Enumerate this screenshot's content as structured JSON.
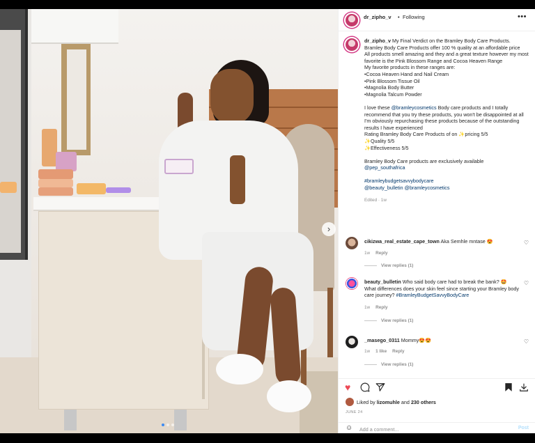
{
  "post": {
    "username": "dr_zipho_v",
    "separator": "•",
    "follow_status": "Following",
    "more_icon": "ellipsis-icon"
  },
  "caption": {
    "username": "dr_zipho_v",
    "lines": [
      "My Final Verdict on the Bramley Body Care Products.",
      "Bramley Body Care Products offer 100 % quality at an affordable price",
      "All products smell amazing and they and a great texture however my most favorite is the Pink Blossom Range and Cocoa Heaven Range",
      "My favorite products in these ranges are:",
      "•Cocoa Heaven Hand and Nail Cream",
      "•Pink Blossom Tissue Oil",
      "•Magnolia Body Butter",
      "•Magnolia Talcum Powder"
    ],
    "para2_prefix": "I love these ",
    "para2_tag": "@bramleycosmetics",
    "para2_suffix": " Body care products and I totally recommend that you try these products, you won't be disappointed at all",
    "para2_lines": [
      "I'm obviously repurchasing these products because of the outstanding results I have experienced",
      "Rating Bramley Body Care Products of on ✨pricing 5/5",
      "✨Quality 5/5",
      "✨Effectiveness 5/5"
    ],
    "para3": "Bramley Body Care products are exclusively available",
    "para3_tag": "@pep_southafrica",
    "hashtag": "#bramleybudgetsavvybodycare",
    "tag_a": "@beauty_bulletin",
    "tag_b": "@bramleycosmetics",
    "edited": "Edited · 1w"
  },
  "comments": [
    {
      "username": "cikizwa_real_estate_cape_town",
      "text": " Aka Semhle mntase 😍",
      "age": "1w",
      "reply": "Reply",
      "view_replies": "View replies (1)"
    },
    {
      "username": "beauty_bulletin",
      "text": " Who said body care had to break the bank? 🤩 What differences does your skin feel since starting your Bramley body care journey? ",
      "tag": "#BramleyBudgetSavvyBodyCare",
      "age": "1w",
      "reply": "Reply",
      "view_replies": "View replies (1)"
    },
    {
      "username": "_masego_0311",
      "text": " Mommy😍😍",
      "age": "1w",
      "likes": "1 like",
      "reply": "Reply",
      "view_replies": "View replies (1)"
    }
  ],
  "actions": {
    "like_icon": "heart-filled-icon",
    "comment_icon": "comment-icon",
    "share_icon": "share-icon",
    "save_icon": "bookmark-icon",
    "download_icon": "download-icon"
  },
  "likes": {
    "prefix": "Liked by ",
    "user": "lizomuhle",
    "middle": " and ",
    "others": "230 others"
  },
  "date": "JUNE 24",
  "add_comment": {
    "placeholder": "Add a comment...",
    "post_label": "Post"
  },
  "colors": {
    "accent_blue": "#0095f6",
    "tag_blue": "#00376b",
    "like_red": "#ed4956"
  }
}
